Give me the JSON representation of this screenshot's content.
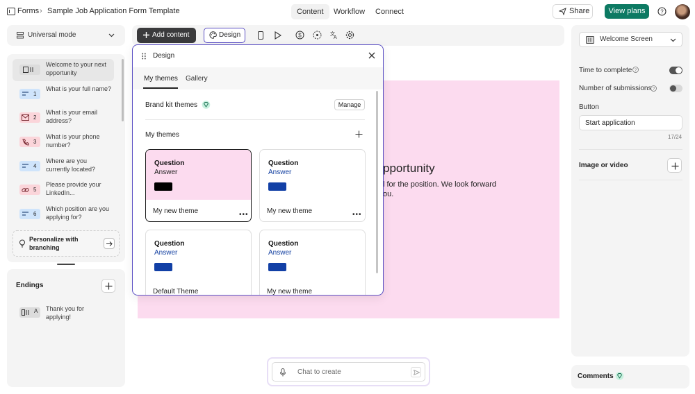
{
  "topbar": {
    "crumb_root": "Forms",
    "crumb_title": "Sample Job Application Form Template",
    "tabs": [
      {
        "label": "Content"
      },
      {
        "label": "Workflow"
      },
      {
        "label": "Connect"
      }
    ],
    "share_label": "Share",
    "plans_label": "View plans"
  },
  "sidebar": {
    "mode_label": "Universal mode",
    "welcome_label": "Welcome to your next opportunity",
    "questions": [
      {
        "number": "1",
        "label": "What is your full name?",
        "color": "#cfe4fb",
        "icon": "short-text-icon"
      },
      {
        "number": "2",
        "label": "What is your email address?",
        "color": "#fbd5da",
        "icon": "envelope-icon"
      },
      {
        "number": "3",
        "label": "What is your phone number?",
        "color": "#fbd5da",
        "icon": "phone-icon"
      },
      {
        "number": "4",
        "label": "Where are you currently located?",
        "color": "#cfe4fb",
        "icon": "short-text-icon"
      },
      {
        "number": "5",
        "label": "Please provide your LinkedIn...",
        "color": "#fbd5da",
        "icon": "link-icon"
      },
      {
        "number": "6",
        "label": "Which position are you applying for?",
        "color": "#cfe4fb",
        "icon": "short-text-icon"
      }
    ],
    "branching_label": "Personalize with branching",
    "endings_title": "Endings",
    "ending_badge": "A",
    "ending_label": "Thank you for applying!"
  },
  "toolbar": {
    "add_content_label": "Add content",
    "design_label": "Design"
  },
  "canvas": {
    "heading_fragment": "pportunity",
    "body_line1": "l for the position. We look forward",
    "body_line2": "ou."
  },
  "design_popup": {
    "title": "Design",
    "tabs": [
      {
        "label": "My themes"
      },
      {
        "label": "Gallery"
      }
    ],
    "brand_kit_label": "Brand kit themes",
    "manage_label": "Manage",
    "my_themes_label": "My themes",
    "cards": [
      {
        "question": "Question",
        "answer": "Answer",
        "name": "My new theme",
        "bg": "#fcdbef",
        "swatch": "#000000"
      },
      {
        "question": "Question",
        "answer": "Answer",
        "name": "My new theme",
        "bg": "#ffffff",
        "swatch": "#1240a6"
      },
      {
        "question": "Question",
        "answer": "Answer",
        "name": "Default Theme",
        "bg": "#ffffff",
        "swatch": "#1240a6"
      },
      {
        "question": "Question",
        "answer": "Answer",
        "name": "My new theme",
        "bg": "#ffffff",
        "swatch": "#1240a6"
      }
    ]
  },
  "chat": {
    "placeholder": "Chat to create"
  },
  "right_panel": {
    "screen_select": "Welcome Screen",
    "time_label": "Time to complete",
    "submissions_label": "Number of submissions",
    "button_label": "Button",
    "button_value": "Start application",
    "char_count": "17/24",
    "media_label": "Image or video",
    "comments_label": "Comments"
  },
  "colors": {
    "accent": "#5b4fc4",
    "primary_button": "#0d7a63",
    "canvas_bg": "#fcdbef"
  }
}
